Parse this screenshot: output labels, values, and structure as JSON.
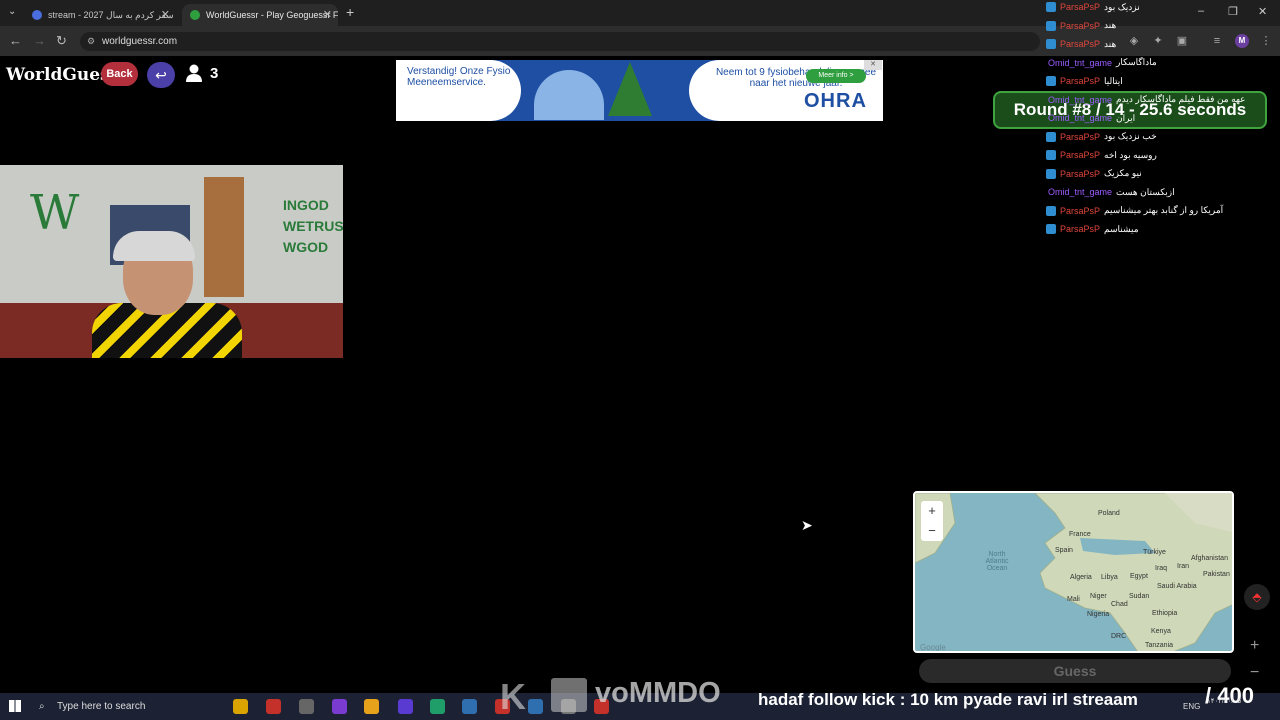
{
  "browser": {
    "tabs": [
      {
        "title": "stream - 2027 سفر کردم به سال",
        "favicon_color": "#4a6ee0"
      },
      {
        "title": "WorldGuessr - Play Geoguessr F...",
        "favicon_color": "#2e9e3e"
      }
    ],
    "url": "worldguessr.com",
    "profile_initial": "M"
  },
  "game": {
    "logo": "WorldGuessr",
    "back_label": "Back",
    "player_count": "3",
    "round_text": "Round #8 / 14 - 25.6 seconds",
    "guess_label": "Guess",
    "compass_icon": "compass-icon"
  },
  "ad": {
    "left_text": "Verstandig! Onze Fysio Meeneemservice.",
    "right_text": "Neem tot 9 fysiobehandelingen mee naar het nieuwe jaar.",
    "cta": "Meer info >",
    "brand": "OHRA"
  },
  "chat": [
    {
      "user": "ParsaPsP",
      "color": "red",
      "text": "نزدیک بود",
      "badge": true
    },
    {
      "user": "ParsaPsP",
      "color": "red",
      "text": "هند",
      "badge": true
    },
    {
      "user": "ParsaPsP",
      "color": "red",
      "text": "هند",
      "badge": true
    },
    {
      "user": "Omid_tnt_game",
      "color": "purple",
      "text": "ماداگاسکار",
      "badge": false
    },
    {
      "user": "ParsaPsP",
      "color": "red",
      "text": "ایتالیا",
      "badge": true
    },
    {
      "user": "Omid_tnt_game",
      "color": "purple",
      "text": "عهه من فقط فیلم ماداگاسکار دیدم",
      "badge": false
    },
    {
      "user": "Omid_tnt_game",
      "color": "purple",
      "text": "ایران",
      "badge": false
    },
    {
      "user": "ParsaPsP",
      "color": "red",
      "text": "خب نزدیک بود",
      "badge": true
    },
    {
      "user": "ParsaPsP",
      "color": "red",
      "text": "روسیه بود اخه",
      "badge": true
    },
    {
      "user": "ParsaPsP",
      "color": "red",
      "text": "نیو مکزیک",
      "badge": true
    },
    {
      "user": "Omid_tnt_game",
      "color": "purple",
      "text": "ازبکستان هست",
      "badge": false
    },
    {
      "user": "ParsaPsP",
      "color": "red",
      "text": "آمریکا رو از گنابد بهتر میشناسیم",
      "badge": true
    },
    {
      "user": "ParsaPsP",
      "color": "red",
      "text": "میشناسم",
      "badge": true
    }
  ],
  "webcam": {
    "graffiti_left": "W",
    "graffiti_right": "INGOD WETRUST WGOD"
  },
  "map": {
    "zoom_in": "+",
    "zoom_out": "−",
    "labels": [
      "Poland",
      "France",
      "Spain",
      "Türkiye",
      "Iraq",
      "Iran",
      "Afghanistan",
      "Pakistan",
      "Saudi Arabia",
      "Egypt",
      "Algeria",
      "Libya",
      "Mali",
      "Niger",
      "Chad",
      "Sudan",
      "Nigeria",
      "Ethiopia",
      "Kenya",
      "DRC",
      "Tanzania",
      "North Atlantic Ocean"
    ],
    "watermark": "Google"
  },
  "overlay": {
    "ticker": "hadaf follow kick : 10 km pyade ravi irl streaam",
    "score": "/ 400",
    "brand": "voMMDO",
    "kick_letter": "K"
  },
  "taskbar": {
    "search_placeholder": "Type here to search",
    "lang": "ENG",
    "clock_line1": "",
    "clock_line2": "۱۴۰۲/۱۰/۰۵",
    "icon_colors": [
      "#d9a400",
      "#c4312b",
      "#666",
      "#7a3bd1",
      "#e7a21c",
      "#5a3bd1",
      "#1f9e6a",
      "#2f6fb0",
      "#c4312b",
      "#2f6fb0",
      "#777",
      "#c4312b"
    ]
  }
}
